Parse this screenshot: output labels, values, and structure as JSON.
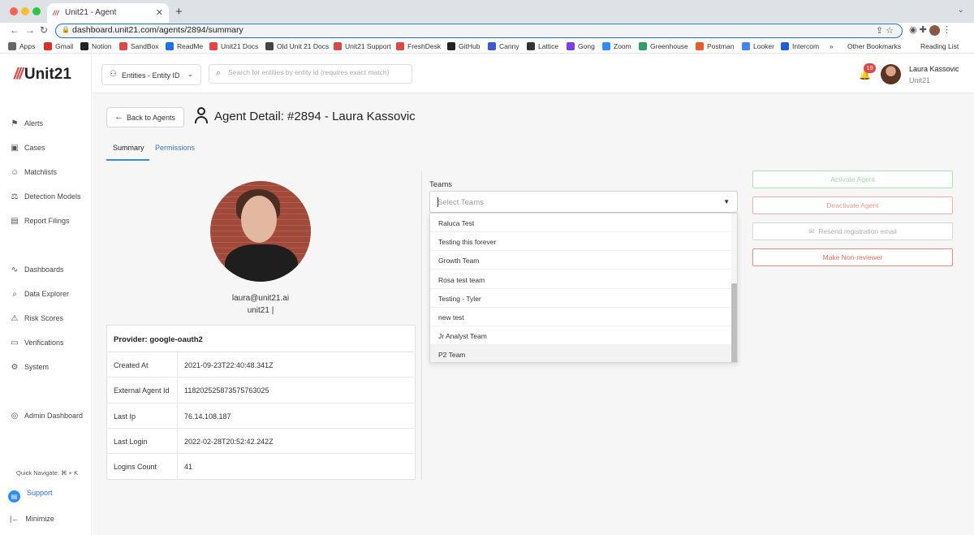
{
  "browser": {
    "tab_title": "Unit21 - Agent",
    "tab_favicon": "///",
    "url": "dashboard.unit21.com/agents/2894/summary",
    "bookmarks": [
      {
        "label": "Apps",
        "color": "#666666"
      },
      {
        "label": "Gmail",
        "color": "#d93025"
      },
      {
        "label": "Notion",
        "color": "#222222"
      },
      {
        "label": "SandBox",
        "color": "#e04747"
      },
      {
        "label": "ReadMe",
        "color": "#1a73e8"
      },
      {
        "label": "Unit21 Docs",
        "color": "#e04747"
      },
      {
        "label": "Old Unit 21 Docs",
        "color": "#444444"
      },
      {
        "label": "Unit21 Support",
        "color": "#e04747"
      },
      {
        "label": "FreshDesk",
        "color": "#e04747"
      },
      {
        "label": "GitHub",
        "color": "#222222"
      },
      {
        "label": "Canny",
        "color": "#3c5ad6"
      },
      {
        "label": "Lattice",
        "color": "#333333"
      },
      {
        "label": "Gong",
        "color": "#7b3fe4"
      },
      {
        "label": "Zoom",
        "color": "#2d8cff"
      },
      {
        "label": "Greenhouse",
        "color": "#2e9e6a"
      },
      {
        "label": "Postman",
        "color": "#ef5b25"
      },
      {
        "label": "Looker",
        "color": "#4285f4"
      },
      {
        "label": "Intercom",
        "color": "#1f5ed8"
      }
    ],
    "more_bookmarks": "»",
    "other_bookmarks": "Other Bookmarks",
    "reading_list": "Reading List"
  },
  "sidebar": {
    "logo_mark": "///",
    "logo_text": "Unit21",
    "items": [
      {
        "label": "Alerts",
        "icon": "flag-icon",
        "glyph": "⚑"
      },
      {
        "label": "Cases",
        "icon": "briefcase-icon",
        "glyph": "▣"
      },
      {
        "label": "Matchlists",
        "icon": "user-plus-icon",
        "glyph": "☺"
      },
      {
        "label": "Detection Models",
        "icon": "scale-icon",
        "glyph": "⚖"
      },
      {
        "label": "Report Filings",
        "icon": "archive-icon",
        "glyph": "▤"
      },
      {
        "label": "Dashboards",
        "icon": "chart-icon",
        "glyph": "∿"
      },
      {
        "label": "Data Explorer",
        "icon": "search-table-icon",
        "glyph": "⌕"
      },
      {
        "label": "Risk Scores",
        "icon": "warning-icon",
        "glyph": "⚠"
      },
      {
        "label": "Verifications",
        "icon": "id-card-icon",
        "glyph": "▭"
      },
      {
        "label": "System",
        "icon": "gear-icon",
        "glyph": "⚙"
      },
      {
        "label": "Admin Dashboard",
        "icon": "globe-icon",
        "glyph": "◎"
      }
    ],
    "quick_navigate": "Quick Navigate: ⌘ + K",
    "support": "Support",
    "minimize": "Minimize"
  },
  "topbar": {
    "entity_select": "Entities - Entity ID",
    "search_placeholder": "Search for entities by entity id (requires exact match)",
    "notification_count": "19",
    "user_name": "Laura Kassovic",
    "user_org": "Unit21"
  },
  "page": {
    "back_button": "Back to Agents",
    "title": "Agent Detail: #2894 - Laura Kassovic",
    "tabs": [
      "Summary",
      "Permissions"
    ],
    "email": "laura@unit21.ai",
    "org": "unit21 |",
    "provider": "Provider: google-oauth2",
    "details": [
      {
        "key": "Created At",
        "value": "2021-09-23T22:40:48.341Z"
      },
      {
        "key": "External Agent Id",
        "value": "118202525873575763025"
      },
      {
        "key": "Last Ip",
        "value": "76.14.108.187"
      },
      {
        "key": "Last Login",
        "value": "2022-02-28T20:52:42.242Z"
      },
      {
        "key": "Logins Count",
        "value": "41"
      }
    ],
    "teams_label": "Teams",
    "teams_placeholder": "Select Teams",
    "team_options": [
      "Raluca Test",
      "Testing this forever",
      "Growth Team",
      "Rosa test team",
      "Testing - Tyler",
      "new test",
      "Jr Analyst Team",
      "P2 Team"
    ],
    "actions": {
      "activate": "Activate Agent",
      "deactivate": "Deactivate Agent",
      "resend": "Resend registration email",
      "non_reviewer": "Make Non-reviewer"
    }
  }
}
